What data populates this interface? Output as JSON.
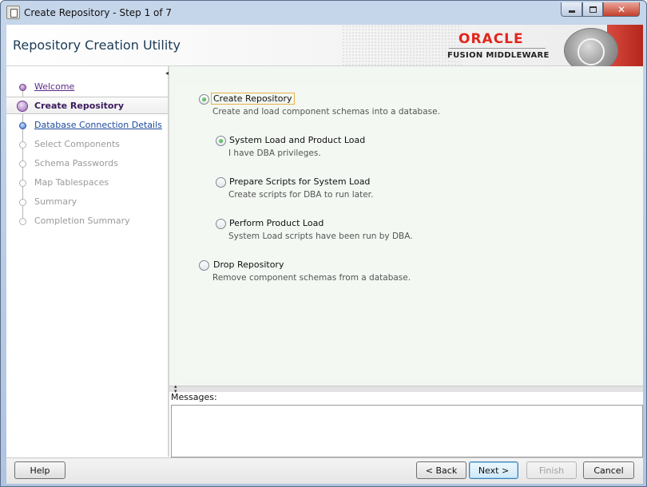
{
  "window": {
    "title": "Create Repository - Step 1 of 7",
    "minimize": "_",
    "maximize": "□",
    "close": "✕"
  },
  "banner": {
    "title": "Repository Creation Utility",
    "brand": "ORACLE",
    "product": "FUSION MIDDLEWARE"
  },
  "nav": {
    "items": [
      {
        "label": "Welcome",
        "state": "done"
      },
      {
        "label": "Create Repository",
        "state": "current"
      },
      {
        "label": "Database Connection Details",
        "state": "next"
      },
      {
        "label": "Select Components",
        "state": "pending"
      },
      {
        "label": "Schema Passwords",
        "state": "pending"
      },
      {
        "label": "Map Tablespaces",
        "state": "pending"
      },
      {
        "label": "Summary",
        "state": "pending"
      },
      {
        "label": "Completion Summary",
        "state": "pending"
      }
    ]
  },
  "options": {
    "create": {
      "label": "Create Repository",
      "desc": "Create and load component schemas into a database.",
      "checked": true
    },
    "system_product": {
      "label": "System Load and Product Load",
      "desc": "I have DBA privileges.",
      "checked": true
    },
    "prepare_scripts": {
      "label": "Prepare Scripts for System Load",
      "desc": "Create scripts for DBA to run later.",
      "checked": false
    },
    "product_load": {
      "label": "Perform Product Load",
      "desc": "System Load scripts have been run by DBA.",
      "checked": false
    },
    "drop": {
      "label": "Drop Repository",
      "desc": "Remove component schemas from a database.",
      "checked": false
    }
  },
  "messages": {
    "label": "Messages:",
    "text": ""
  },
  "buttons": {
    "help": "Help",
    "back": "< Back",
    "next": "Next >",
    "finish": "Finish",
    "cancel": "Cancel"
  },
  "colors": {
    "accent_purple": "#5a2a86",
    "link_blue": "#1c4a9e",
    "oracle_red": "#e1261c",
    "content_bg": "#f2f7f2"
  }
}
